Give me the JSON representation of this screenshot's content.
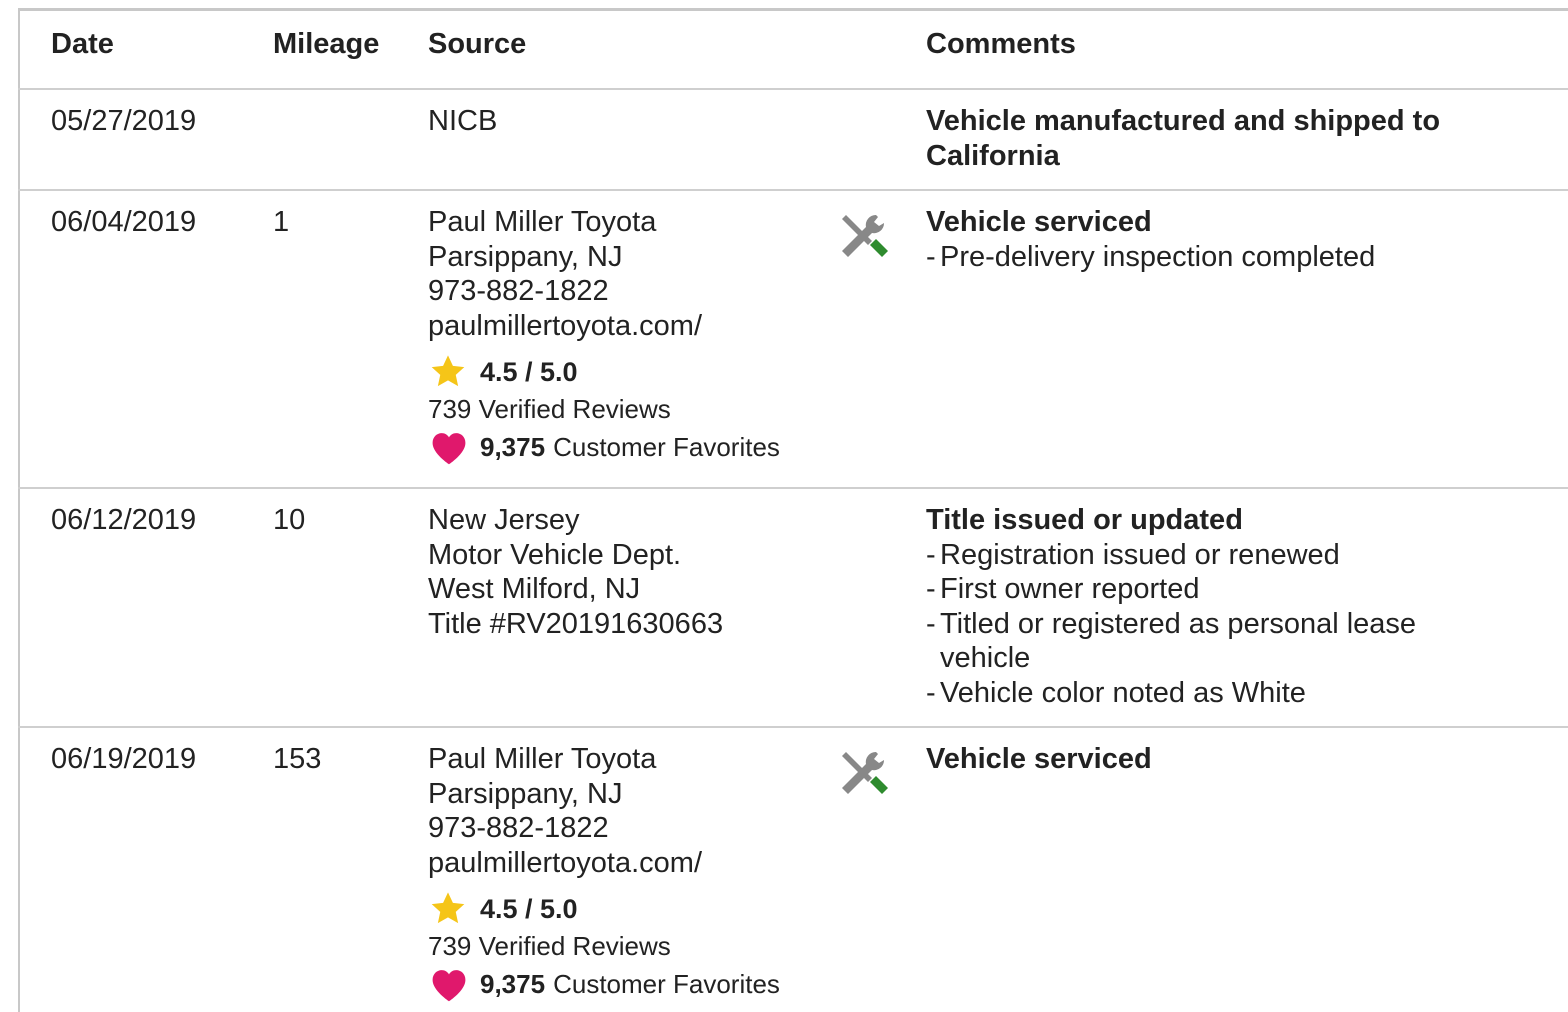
{
  "headers": {
    "date": "Date",
    "mileage": "Mileage",
    "source": "Source",
    "comments": "Comments"
  },
  "rows": [
    {
      "date": "05/27/2019",
      "mileage": "",
      "source": [
        "NICB"
      ],
      "comment_title_lines": [
        "Vehicle manufactured and shipped to",
        "California"
      ]
    },
    {
      "date": "06/04/2019",
      "mileage": "1",
      "source": [
        "Paul Miller Toyota",
        "Parsippany, NJ",
        "973-882-1822",
        "paulmillertoyota.com/"
      ],
      "rating": "4.5 / 5.0",
      "reviews": "739 Verified Reviews",
      "favorites_count": "9,375",
      "favorites_label": "Customer Favorites",
      "icon": "service-tools-icon",
      "comment_title": "Vehicle serviced",
      "comment_items": [
        "Pre-delivery inspection completed"
      ]
    },
    {
      "date": "06/12/2019",
      "mileage": "10",
      "source": [
        "New Jersey",
        "Motor Vehicle Dept.",
        "West Milford, NJ",
        "Title #RV20191630663"
      ],
      "comment_title": "Title issued or updated",
      "comment_items": [
        "Registration issued or renewed",
        "First owner reported",
        "Titled or registered as personal lease",
        "vehicle",
        "Vehicle color noted as White"
      ]
    },
    {
      "date": "06/19/2019",
      "mileage": "153",
      "source": [
        "Paul Miller Toyota",
        "Parsippany, NJ",
        "973-882-1822",
        "paulmillertoyota.com/"
      ],
      "rating": "4.5 / 5.0",
      "reviews": "739 Verified Reviews",
      "favorites_count": "9,375",
      "favorites_label": "Customer Favorites",
      "icon": "service-tools-icon",
      "comment_title": "Vehicle serviced"
    }
  ],
  "colors": {
    "star": "#f5c518",
    "heart": "#e0186c",
    "tool_gray": "#888888",
    "tool_green": "#2e8b2e",
    "divider": "#cfcfcf"
  }
}
